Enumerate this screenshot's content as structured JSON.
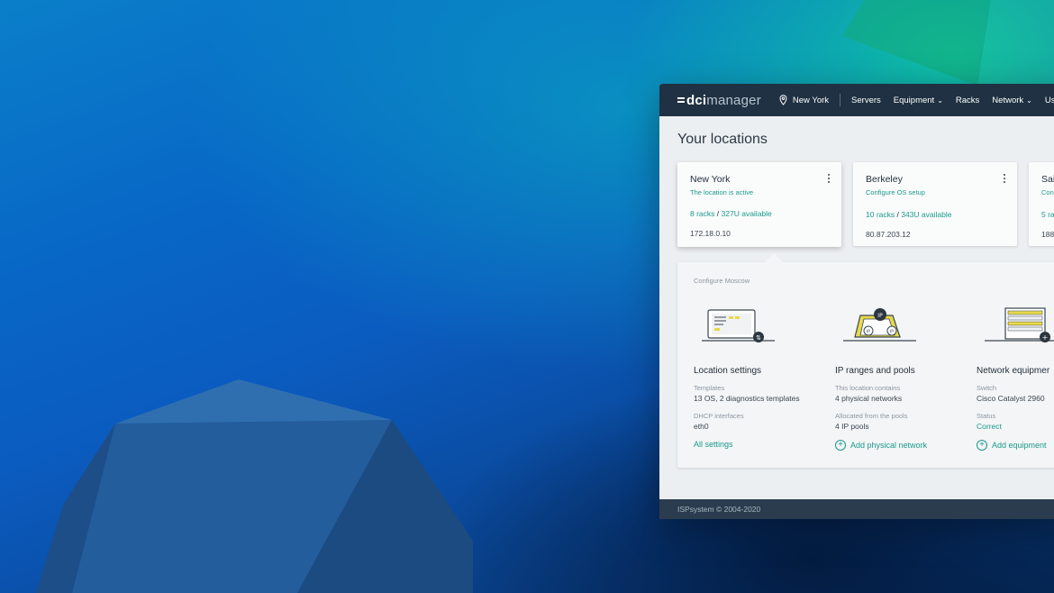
{
  "app": {
    "logo_brand": "dci",
    "logo_product": "manager"
  },
  "topbar": {
    "location": "New York",
    "nav": [
      {
        "label": "Servers",
        "dropdown": false
      },
      {
        "label": "Equipment",
        "dropdown": true
      },
      {
        "label": "Racks",
        "dropdown": false
      },
      {
        "label": "Network",
        "dropdown": true
      },
      {
        "label": "Users",
        "dropdown": false
      }
    ]
  },
  "page": {
    "title": "Your locations"
  },
  "locations": [
    {
      "name": "New York",
      "status": "The location is active",
      "racks": "8 racks",
      "available": "327U available",
      "ip": "172.18.0.10"
    },
    {
      "name": "Berkeley",
      "status": "Configure OS setup",
      "racks": "10 racks",
      "available": "343U available",
      "ip": "80.87.203.12"
    },
    {
      "name": "Sai",
      "status": "Con",
      "racks": "5 ra",
      "available": "",
      "ip": "188"
    }
  ],
  "config": {
    "caption": "Configure Moscow",
    "columns": [
      {
        "title": "Location settings",
        "fields": [
          {
            "label": "Templates",
            "value": "13 OS, 2 diagnostics templates"
          },
          {
            "label": "DHCP interfaces",
            "value": "eth0"
          }
        ],
        "action": "All settings"
      },
      {
        "title": "IP ranges and pools",
        "fields": [
          {
            "label": "This location contains",
            "value": "4 physical networks"
          },
          {
            "label": "Allocated from the pools",
            "value": "4 IP pools"
          }
        ],
        "action": "Add physical network"
      },
      {
        "title": "Network equipmer",
        "fields": [
          {
            "label": "Switch",
            "value": "Cisco Catalyst 2960"
          },
          {
            "label": "Status",
            "value": "Correct"
          }
        ],
        "action": "Add equipment"
      }
    ]
  },
  "footer": {
    "copyright": "ISPsystem © 2004-2020"
  },
  "colors": {
    "accent": "#1a9a8e",
    "topbar": "#1f3142",
    "footer": "#2a3c4d"
  }
}
